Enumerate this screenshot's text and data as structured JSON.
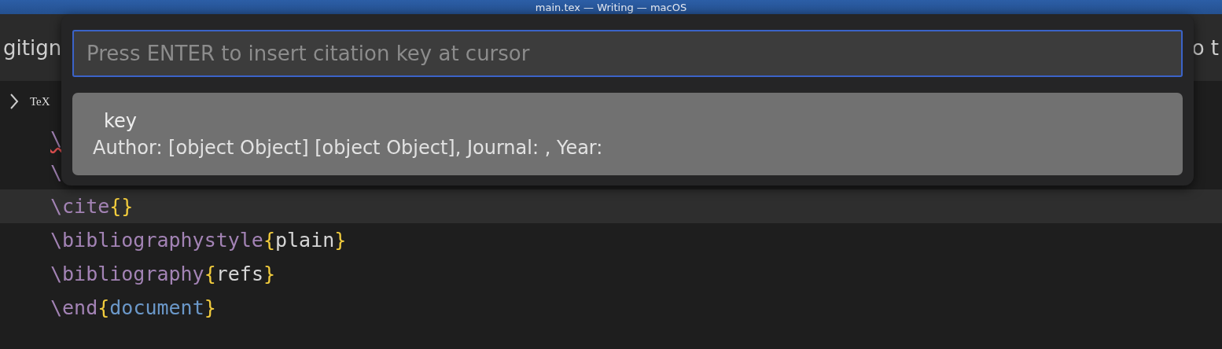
{
  "window": {
    "title": "main.tex — Writing — macOS"
  },
  "tabs": [
    {
      "label": "gitign",
      "selected": false
    },
    {
      "label": "o t",
      "selected": false
    }
  ],
  "breadcrumbs": {
    "file_icon": "TeX"
  },
  "editor": {
    "lines": [
      {
        "current": false,
        "squiggle": true,
        "segments": [
          {
            "kind": "command",
            "text": "\\"
          }
        ]
      },
      {
        "current": false,
        "squiggle": false,
        "segments": [
          {
            "kind": "command",
            "text": "\\"
          }
        ]
      },
      {
        "current": true,
        "squiggle": false,
        "segments": [
          {
            "kind": "command",
            "text": "\\cite"
          },
          {
            "kind": "brace",
            "text": "{}"
          }
        ]
      },
      {
        "current": false,
        "squiggle": false,
        "segments": [
          {
            "kind": "command",
            "text": "\\bibliographystyle"
          },
          {
            "kind": "brace",
            "text": "{"
          },
          {
            "kind": "text",
            "text": "plain"
          },
          {
            "kind": "brace",
            "text": "}"
          }
        ]
      },
      {
        "current": false,
        "squiggle": false,
        "segments": [
          {
            "kind": "command",
            "text": "\\bibliography"
          },
          {
            "kind": "brace",
            "text": "{"
          },
          {
            "kind": "text",
            "text": "refs"
          },
          {
            "kind": "brace",
            "text": "}"
          }
        ]
      },
      {
        "current": false,
        "squiggle": false,
        "segments": [
          {
            "kind": "command",
            "text": "\\end"
          },
          {
            "kind": "brace",
            "text": "{"
          },
          {
            "kind": "environment",
            "text": "document"
          },
          {
            "kind": "brace",
            "text": "}"
          }
        ]
      }
    ]
  },
  "quick_pick": {
    "placeholder": "Press ENTER to insert citation key at cursor",
    "items": [
      {
        "label": "key",
        "detail": "Author: [object Object] [object Object], Journal: , Year:",
        "selected": true
      }
    ]
  }
}
